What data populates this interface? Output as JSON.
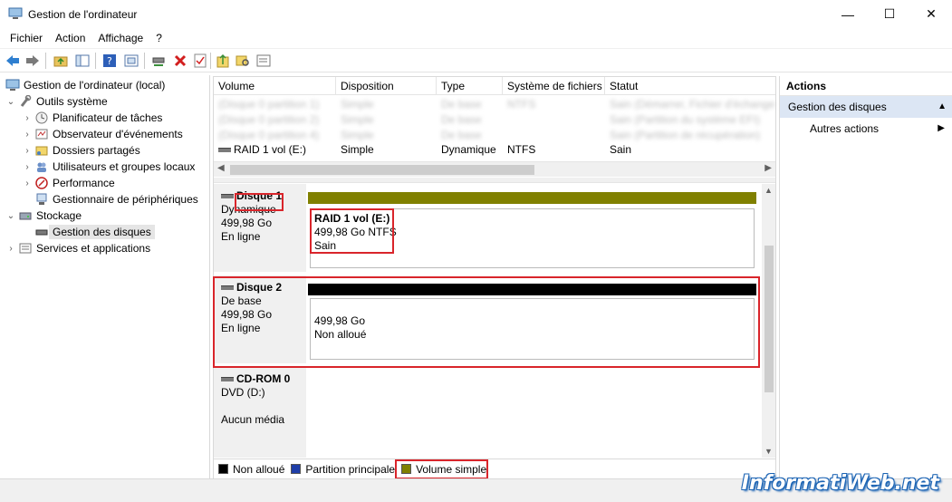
{
  "window": {
    "title": "Gestion de l'ordinateur",
    "minimize": "—",
    "maximize": "☐",
    "close": "✕"
  },
  "menu": [
    "Fichier",
    "Action",
    "Affichage",
    "?"
  ],
  "tree": {
    "root": "Gestion de l'ordinateur (local)",
    "items": [
      {
        "label": "Outils système",
        "level": 1,
        "expanded": true
      },
      {
        "label": "Planificateur de tâches",
        "level": 2
      },
      {
        "label": "Observateur d'événements",
        "level": 2
      },
      {
        "label": "Dossiers partagés",
        "level": 2
      },
      {
        "label": "Utilisateurs et groupes locaux",
        "level": 2
      },
      {
        "label": "Performance",
        "level": 2
      },
      {
        "label": "Gestionnaire de périphériques",
        "level": 2
      },
      {
        "label": "Stockage",
        "level": 1,
        "expanded": true
      },
      {
        "label": "Gestion des disques",
        "level": 2,
        "selected": true
      },
      {
        "label": "Services et applications",
        "level": 1
      }
    ]
  },
  "volume_list": {
    "headers": [
      "Volume",
      "Disposition",
      "Type",
      "Système de fichiers",
      "Statut"
    ],
    "blurred_rows": [
      [
        "(Disque 0 partition 1)",
        "Simple",
        "De base",
        "NTFS",
        "Sain (Démarrer, Fichier d'échange)"
      ],
      [
        "(Disque 0 partition 2)",
        "Simple",
        "De base",
        "",
        "Sain (Partition du système EFI)"
      ],
      [
        "(Disque 0 partition 4)",
        "Simple",
        "De base",
        "",
        "Sain (Partition de récupération)"
      ]
    ],
    "rows": [
      {
        "volume": "RAID 1 vol (E:)",
        "layout": "Simple",
        "type": "Dynamique",
        "fs": "NTFS",
        "status": "Sain"
      }
    ]
  },
  "disks": [
    {
      "name": "Disque 1",
      "kind": "Dynamique",
      "size": "499,98 Go",
      "state": "En ligne",
      "bar_color": "#808000",
      "partition": {
        "title": "RAID 1 vol  (E:)",
        "line1": "499,98 Go NTFS",
        "line2": "Sain"
      }
    },
    {
      "name": "Disque 2",
      "kind": "De base",
      "size": "499,98 Go",
      "state": "En ligne",
      "bar_color": "#000000",
      "partition": {
        "line1": "499,98 Go",
        "line2": "Non alloué"
      }
    },
    {
      "name": "CD-ROM 0",
      "kind": "DVD (D:)",
      "state": "Aucun média"
    }
  ],
  "legend": [
    {
      "label": "Non alloué",
      "color": "#000000"
    },
    {
      "label": "Partition principale",
      "color": "#1f3ea8"
    },
    {
      "label": "Volume simple",
      "color": "#808000"
    }
  ],
  "actions": {
    "header": "Actions",
    "section": "Gestion des disques",
    "items": [
      "Autres actions"
    ]
  },
  "watermark": "InformatiWeb.net",
  "colors": {
    "highlight": "#d9252b",
    "selection": "#dce6f4"
  }
}
